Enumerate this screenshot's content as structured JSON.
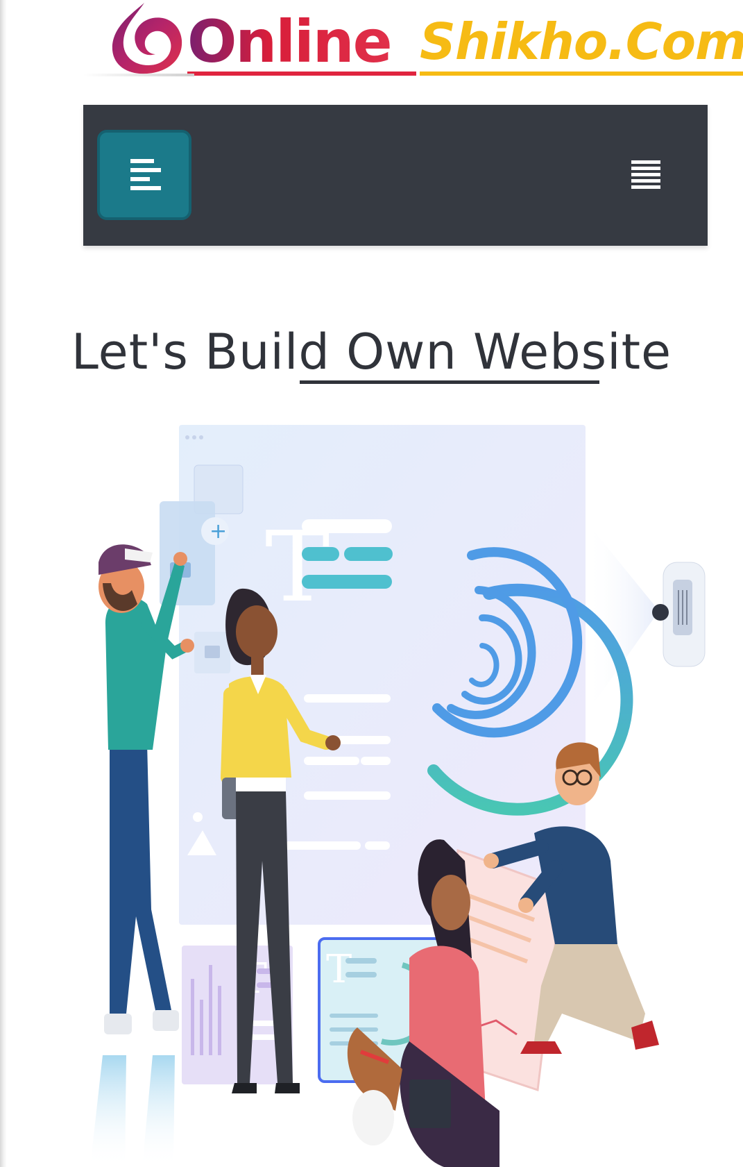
{
  "logo": {
    "online": "Online",
    "shikho": "Shikho.Com"
  },
  "navbar": {
    "left_menu_icon": "align-left-icon",
    "right_menu_icon": "hamburger-menu-icon"
  },
  "hero": {
    "heading": "Let's Build Own Website",
    "illustration": "website-builder-team-illustration"
  },
  "colors": {
    "nav_bg": "#363a42",
    "menu_button": "#1b7a8a",
    "logo_red": "#e0243f",
    "logo_yellow": "#f6bb14",
    "heading_text": "#30333a"
  }
}
